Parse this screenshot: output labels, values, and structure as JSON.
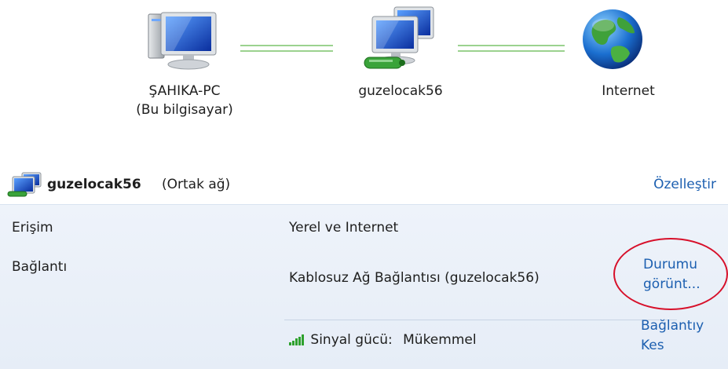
{
  "network_map": {
    "computer": {
      "name": "ŞAHIKA-PC",
      "subtitle": "(Bu bilgisayar)",
      "icon": "computer-icon"
    },
    "router": {
      "name": "guzelocak56",
      "icon": "network-router-icon"
    },
    "internet": {
      "name": "Internet",
      "icon": "globe-icon"
    }
  },
  "network": {
    "name": "guzelocak56",
    "category": "(Ortak ağ)",
    "customize_label": "Özelleştir",
    "icon": "wireless-network-icon"
  },
  "details": {
    "access_label": "Erişim",
    "access_value": "Yerel ve Internet",
    "connection_label": "Bağlantı",
    "connection_value": "Kablosuz Ağ Bağlantısı (guzelocak56)",
    "view_status_label_line1": "Durumu",
    "view_status_label_line2": "görünt...",
    "signal_label": "Sinyal gücü:",
    "signal_value": "Mükemmel",
    "signal_level": "5/5",
    "disconnect_label_line1": "Bağlantıy",
    "disconnect_label_line2": "Kes"
  },
  "colors": {
    "link": "#1c5fb0",
    "highlight_ellipse": "#d7102a",
    "connection_line": "#9bd28f",
    "panel_background": "#eef3fa"
  }
}
